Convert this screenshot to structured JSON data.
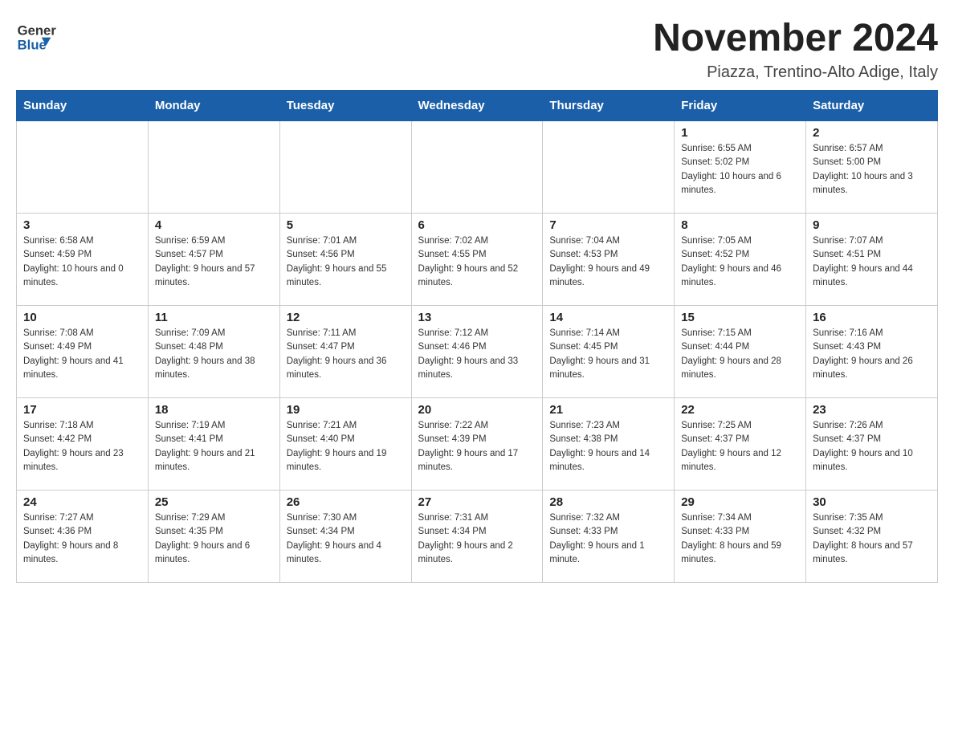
{
  "header": {
    "logo": {
      "general": "General",
      "blue": "Blue"
    },
    "title": "November 2024",
    "subtitle": "Piazza, Trentino-Alto Adige, Italy"
  },
  "calendar": {
    "days_of_week": [
      "Sunday",
      "Monday",
      "Tuesday",
      "Wednesday",
      "Thursday",
      "Friday",
      "Saturday"
    ],
    "weeks": [
      {
        "days": [
          {
            "number": "",
            "info": ""
          },
          {
            "number": "",
            "info": ""
          },
          {
            "number": "",
            "info": ""
          },
          {
            "number": "",
            "info": ""
          },
          {
            "number": "",
            "info": ""
          },
          {
            "number": "1",
            "info": "Sunrise: 6:55 AM\nSunset: 5:02 PM\nDaylight: 10 hours and 6 minutes."
          },
          {
            "number": "2",
            "info": "Sunrise: 6:57 AM\nSunset: 5:00 PM\nDaylight: 10 hours and 3 minutes."
          }
        ]
      },
      {
        "days": [
          {
            "number": "3",
            "info": "Sunrise: 6:58 AM\nSunset: 4:59 PM\nDaylight: 10 hours and 0 minutes."
          },
          {
            "number": "4",
            "info": "Sunrise: 6:59 AM\nSunset: 4:57 PM\nDaylight: 9 hours and 57 minutes."
          },
          {
            "number": "5",
            "info": "Sunrise: 7:01 AM\nSunset: 4:56 PM\nDaylight: 9 hours and 55 minutes."
          },
          {
            "number": "6",
            "info": "Sunrise: 7:02 AM\nSunset: 4:55 PM\nDaylight: 9 hours and 52 minutes."
          },
          {
            "number": "7",
            "info": "Sunrise: 7:04 AM\nSunset: 4:53 PM\nDaylight: 9 hours and 49 minutes."
          },
          {
            "number": "8",
            "info": "Sunrise: 7:05 AM\nSunset: 4:52 PM\nDaylight: 9 hours and 46 minutes."
          },
          {
            "number": "9",
            "info": "Sunrise: 7:07 AM\nSunset: 4:51 PM\nDaylight: 9 hours and 44 minutes."
          }
        ]
      },
      {
        "days": [
          {
            "number": "10",
            "info": "Sunrise: 7:08 AM\nSunset: 4:49 PM\nDaylight: 9 hours and 41 minutes."
          },
          {
            "number": "11",
            "info": "Sunrise: 7:09 AM\nSunset: 4:48 PM\nDaylight: 9 hours and 38 minutes."
          },
          {
            "number": "12",
            "info": "Sunrise: 7:11 AM\nSunset: 4:47 PM\nDaylight: 9 hours and 36 minutes."
          },
          {
            "number": "13",
            "info": "Sunrise: 7:12 AM\nSunset: 4:46 PM\nDaylight: 9 hours and 33 minutes."
          },
          {
            "number": "14",
            "info": "Sunrise: 7:14 AM\nSunset: 4:45 PM\nDaylight: 9 hours and 31 minutes."
          },
          {
            "number": "15",
            "info": "Sunrise: 7:15 AM\nSunset: 4:44 PM\nDaylight: 9 hours and 28 minutes."
          },
          {
            "number": "16",
            "info": "Sunrise: 7:16 AM\nSunset: 4:43 PM\nDaylight: 9 hours and 26 minutes."
          }
        ]
      },
      {
        "days": [
          {
            "number": "17",
            "info": "Sunrise: 7:18 AM\nSunset: 4:42 PM\nDaylight: 9 hours and 23 minutes."
          },
          {
            "number": "18",
            "info": "Sunrise: 7:19 AM\nSunset: 4:41 PM\nDaylight: 9 hours and 21 minutes."
          },
          {
            "number": "19",
            "info": "Sunrise: 7:21 AM\nSunset: 4:40 PM\nDaylight: 9 hours and 19 minutes."
          },
          {
            "number": "20",
            "info": "Sunrise: 7:22 AM\nSunset: 4:39 PM\nDaylight: 9 hours and 17 minutes."
          },
          {
            "number": "21",
            "info": "Sunrise: 7:23 AM\nSunset: 4:38 PM\nDaylight: 9 hours and 14 minutes."
          },
          {
            "number": "22",
            "info": "Sunrise: 7:25 AM\nSunset: 4:37 PM\nDaylight: 9 hours and 12 minutes."
          },
          {
            "number": "23",
            "info": "Sunrise: 7:26 AM\nSunset: 4:37 PM\nDaylight: 9 hours and 10 minutes."
          }
        ]
      },
      {
        "days": [
          {
            "number": "24",
            "info": "Sunrise: 7:27 AM\nSunset: 4:36 PM\nDaylight: 9 hours and 8 minutes."
          },
          {
            "number": "25",
            "info": "Sunrise: 7:29 AM\nSunset: 4:35 PM\nDaylight: 9 hours and 6 minutes."
          },
          {
            "number": "26",
            "info": "Sunrise: 7:30 AM\nSunset: 4:34 PM\nDaylight: 9 hours and 4 minutes."
          },
          {
            "number": "27",
            "info": "Sunrise: 7:31 AM\nSunset: 4:34 PM\nDaylight: 9 hours and 2 minutes."
          },
          {
            "number": "28",
            "info": "Sunrise: 7:32 AM\nSunset: 4:33 PM\nDaylight: 9 hours and 1 minute."
          },
          {
            "number": "29",
            "info": "Sunrise: 7:34 AM\nSunset: 4:33 PM\nDaylight: 8 hours and 59 minutes."
          },
          {
            "number": "30",
            "info": "Sunrise: 7:35 AM\nSunset: 4:32 PM\nDaylight: 8 hours and 57 minutes."
          }
        ]
      }
    ]
  }
}
